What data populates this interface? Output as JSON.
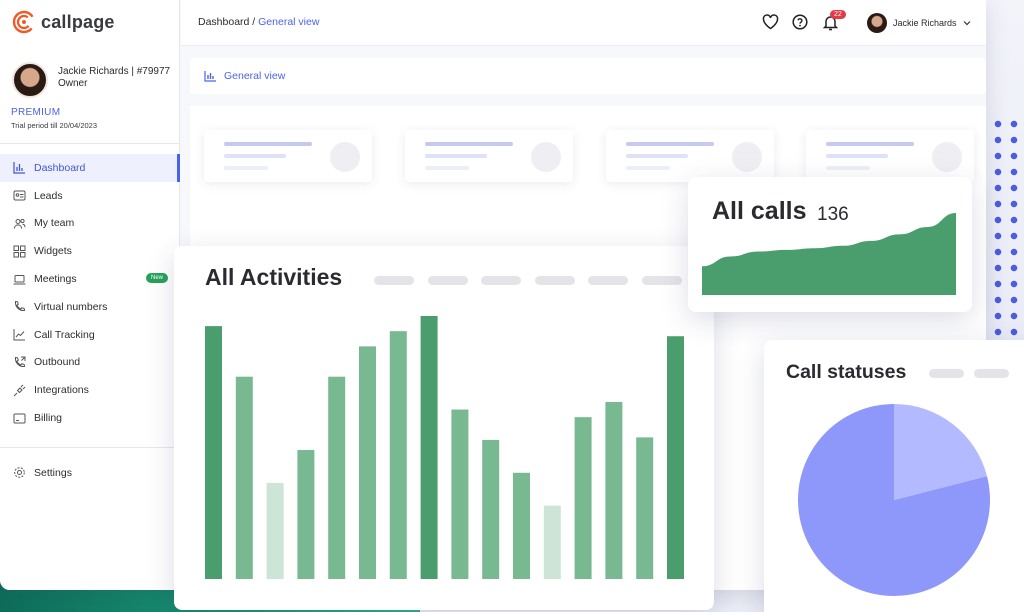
{
  "brand": {
    "name": "callpage"
  },
  "profile": {
    "name_id": "Jackie Richards | #79977",
    "role": "Owner",
    "plan": "PREMIUM",
    "trial": "Trial period till 20/04/2023"
  },
  "nav": [
    {
      "label": "Dashboard",
      "icon": "dashboard-icon",
      "active": true
    },
    {
      "label": "Leads",
      "icon": "contact-card-icon"
    },
    {
      "label": "My team",
      "icon": "team-icon"
    },
    {
      "label": "Widgets",
      "icon": "widgets-icon"
    },
    {
      "label": "Meetings",
      "icon": "laptop-icon",
      "badge": "New"
    },
    {
      "label": "Virtual numbers",
      "icon": "phone-icon"
    },
    {
      "label": "Call Tracking",
      "icon": "trend-icon"
    },
    {
      "label": "Outbound",
      "icon": "phone-outgoing-icon"
    },
    {
      "label": "Integrations",
      "icon": "plug-icon"
    },
    {
      "label": "Billing",
      "icon": "billing-icon"
    }
  ],
  "settings_label": "Settings",
  "breadcrumb": {
    "root": "Dashboard",
    "separator": " / ",
    "current": "General view"
  },
  "topbar": {
    "notifications": "22",
    "user_name": "Jackie Richards"
  },
  "view": {
    "label": "General view"
  },
  "activities": {
    "title": "All Activities"
  },
  "all_calls": {
    "title": "All calls",
    "count": "136"
  },
  "call_statuses": {
    "title": "Call statuses"
  },
  "colors": {
    "accent": "#4b63e8",
    "green_dark": "#4a9e6e",
    "green_mid": "#79b992",
    "green_light": "#cde5d7",
    "pie_main": "#8e98fb",
    "pie_slice": "#b4baff",
    "badge_red": "#e63946"
  },
  "chart_data": [
    {
      "type": "bar",
      "title": "All Activities",
      "categories": [],
      "values": [
        100,
        80,
        38,
        51,
        80,
        92,
        98,
        104,
        67,
        55,
        42,
        29,
        64,
        70,
        56,
        96
      ],
      "ylim": [
        0,
        104
      ]
    },
    {
      "type": "area",
      "title": "All calls",
      "values": [
        35,
        47,
        53,
        55,
        57,
        60,
        66,
        74,
        83,
        100
      ]
    },
    {
      "type": "pie",
      "title": "Call statuses",
      "values": [
        79,
        21
      ]
    }
  ]
}
